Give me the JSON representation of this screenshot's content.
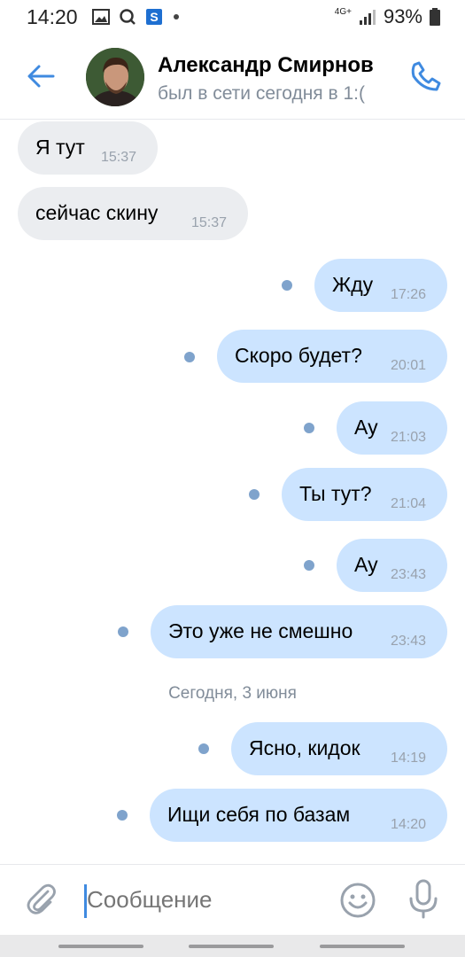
{
  "status_bar": {
    "time": "14:20",
    "network": "4G+",
    "battery": "93%"
  },
  "header": {
    "name": "Александр Смирнов",
    "status": "был в сети сегодня в 1:("
  },
  "messages": [
    {
      "dir": "in",
      "text": "Я тут",
      "time": "15:37"
    },
    {
      "dir": "in",
      "text": "сейчас скину",
      "time": "15:37"
    },
    {
      "dir": "out",
      "text": "Жду",
      "time": "17:26"
    },
    {
      "dir": "out",
      "text": "Скоро будет?",
      "time": "20:01"
    },
    {
      "dir": "out",
      "text": "Ау",
      "time": "21:03"
    },
    {
      "dir": "out",
      "text": "Ты тут?",
      "time": "21:04"
    },
    {
      "dir": "out",
      "text": "Ау",
      "time": "23:43"
    },
    {
      "dir": "out",
      "text": "Это уже не смешно",
      "time": "23:43"
    },
    {
      "dir": "out",
      "text": "Ясно, кидок",
      "time": "14:19"
    },
    {
      "dir": "out",
      "text": "Ищи себя по базам",
      "time": "14:20"
    }
  ],
  "date_separator": "Сегодня, 3 июня",
  "composer": {
    "placeholder": "Сообщение"
  },
  "colors": {
    "accent": "#3f8ae0",
    "bubble_out": "#cce4ff",
    "bubble_in": "#ebedf0",
    "unread_dot": "#7fa3cc"
  }
}
